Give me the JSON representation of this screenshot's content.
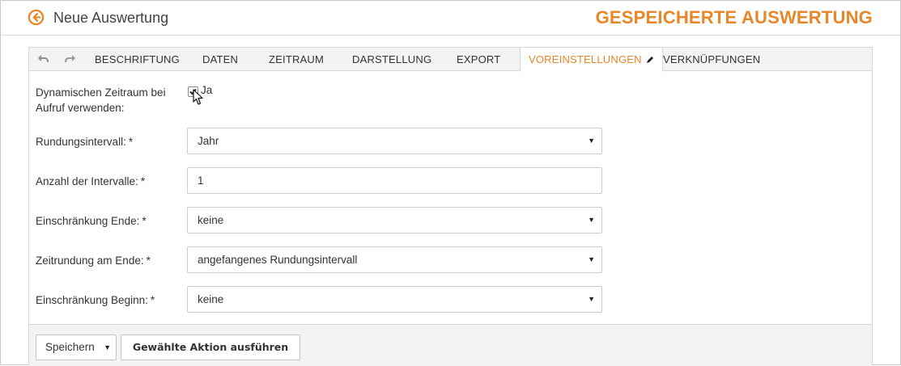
{
  "header": {
    "back_icon": "arrow-left-circle-icon",
    "title": "Neue Auswertung",
    "brand_title": "GESPEICHERTE AUSWERTUNG",
    "accent_color": "#e8862a"
  },
  "toolbar": {
    "undo_icon": "undo-icon",
    "redo_icon": "redo-icon"
  },
  "tabs": [
    {
      "label": "BESCHRIFTUNG"
    },
    {
      "label": "DATEN"
    },
    {
      "label": "ZEITRAUM"
    },
    {
      "label": "DARSTELLUNG"
    },
    {
      "label": "EXPORT"
    },
    {
      "label": "VOREINSTELLUNGEN",
      "active": true,
      "icon": "pencil-icon"
    },
    {
      "label": "VERKNÜPFUNGEN"
    }
  ],
  "form": {
    "dynamic_range": {
      "label_line1": "Dynamischen Zeitraum bei",
      "label_line2": "Aufruf verwenden:",
      "checked": true,
      "option_label": "Ja"
    },
    "fields": [
      {
        "label": "Rundungsintervall:",
        "required": "*",
        "value": "Jahr",
        "type": "select"
      },
      {
        "label": "Anzahl der Intervalle:",
        "required": "*",
        "value": "1",
        "type": "input"
      },
      {
        "label": "Einschränkung Ende:",
        "required": "*",
        "value": "keine",
        "type": "select"
      },
      {
        "label": "Zeitrundung am Ende:",
        "required": "*",
        "value": "angefangenes Rundungsintervall",
        "type": "select"
      },
      {
        "label": "Einschränkung Beginn:",
        "required": "*",
        "value": "keine",
        "type": "select"
      }
    ]
  },
  "footer": {
    "save_label": "Speichern",
    "action_label": "Gewählte Aktion ausführen"
  }
}
